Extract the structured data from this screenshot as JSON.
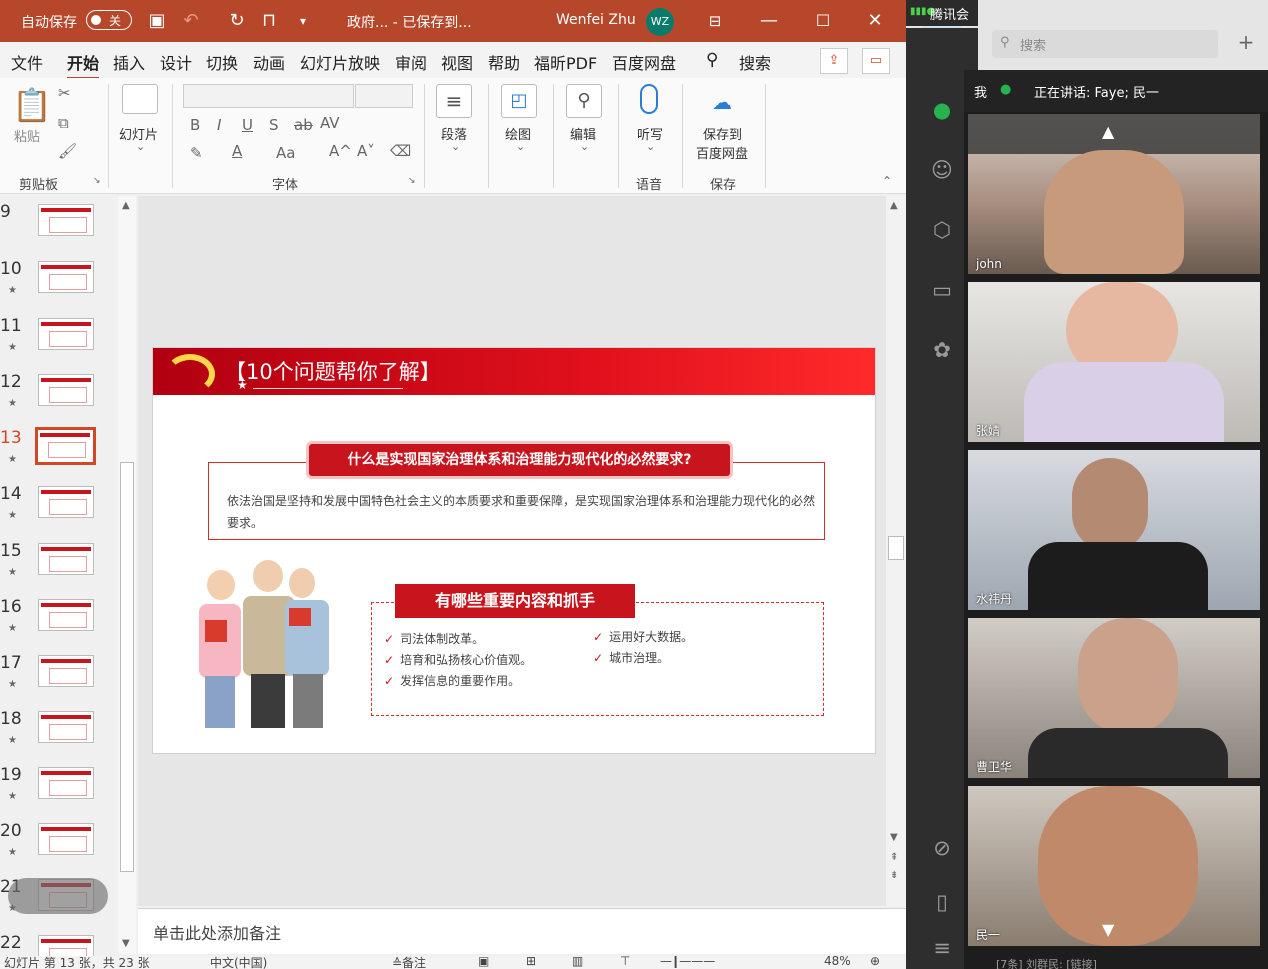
{
  "ppt": {
    "titlebar": {
      "autosave_label": "自动保存",
      "autosave_state": "关",
      "doc_title": "政府...  -  已保存到...",
      "user_name": "Wenfei Zhu",
      "user_initials": "WZ"
    },
    "tabs": [
      "文件",
      "开始",
      "插入",
      "设计",
      "切换",
      "动画",
      "幻灯片放映",
      "审阅",
      "视图",
      "帮助",
      "福昕PDF",
      "百度网盘"
    ],
    "active_tab": "开始",
    "search_label": "搜索",
    "ribbon": {
      "paste_label": "粘贴",
      "clipboard_label": "剪贴板",
      "slides_label": "幻灯片",
      "font_label": "字体",
      "paragraph_label": "段落",
      "drawing_label": "绘图",
      "editing_label": "编辑",
      "dictate_label": "听写",
      "voice_label": "语音",
      "save_baidu_label_1": "保存到",
      "save_baidu_label_2": "百度网盘",
      "save_label": "保存",
      "bold": "B",
      "italic": "I",
      "underline": "U",
      "shadow": "S",
      "strike": "ab",
      "spacing": "AV",
      "fontcolor": "A",
      "case": "Aa",
      "grow": "A^",
      "shrink": "A˅"
    },
    "thumbnails": [
      {
        "num": "9",
        "star": ""
      },
      {
        "num": "10",
        "star": "★"
      },
      {
        "num": "11",
        "star": "★"
      },
      {
        "num": "12",
        "star": "★"
      },
      {
        "num": "13",
        "star": "★"
      },
      {
        "num": "14",
        "star": "★"
      },
      {
        "num": "15",
        "star": "★"
      },
      {
        "num": "16",
        "star": "★"
      },
      {
        "num": "17",
        "star": "★"
      },
      {
        "num": "18",
        "star": "★"
      },
      {
        "num": "19",
        "star": "★"
      },
      {
        "num": "20",
        "star": "★"
      },
      {
        "num": "21",
        "star": "★"
      },
      {
        "num": "22",
        "star": ""
      }
    ],
    "slide": {
      "title": "【10个问题帮你了解】",
      "question": "什么是实现国家治理体系和治理能力现代化的必然要求?",
      "answer": "依法治国是坚持和发展中国特色社会主义的本质要求和重要保障，是实现国家治理体系和治理能力现代化的必然要求。",
      "section2": "有哪些重要内容和抓手",
      "bullets_left": [
        "司法体制改革。",
        "培育和弘扬核心价值观。",
        "发挥信息的重要作用。"
      ],
      "bullets_right": [
        "运用好大数据。",
        "城市治理。"
      ]
    },
    "notes_placeholder": "单击此处添加备注",
    "status": {
      "slide_info": "幻灯片 第 13 张，共 23 张",
      "language": "中文(中国)",
      "notes_btn": "≙备注",
      "zoom": "48%"
    }
  },
  "tencent": {
    "app_name": "腾讯会议",
    "search_placeholder": "搜索",
    "me_label": "我",
    "speaking": "正在讲话: Faye; 民一",
    "participants": [
      {
        "name": "john",
        "muted": true
      },
      {
        "name": "张婧",
        "muted": false
      },
      {
        "name": "水祎丹",
        "muted": true
      },
      {
        "name": "曹卫华",
        "muted": true
      },
      {
        "name": "民一",
        "muted": false
      }
    ],
    "bottom_text": "[7条] 刘群民: [链接]"
  }
}
